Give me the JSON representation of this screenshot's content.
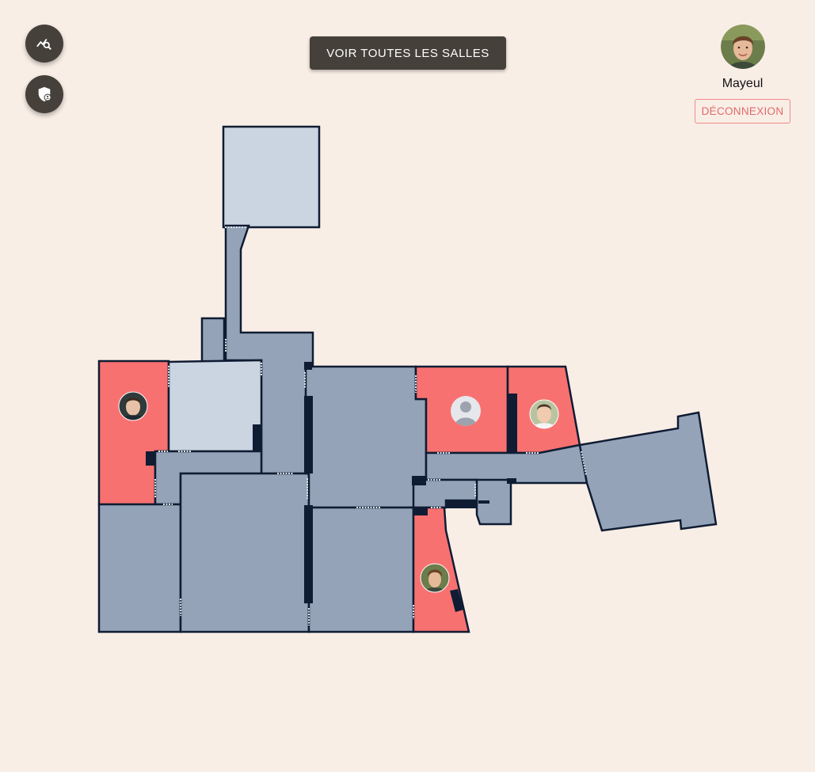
{
  "toolbar": {
    "stats_icon": "stats-search-icon",
    "admin_icon": "shield-user-icon"
  },
  "header": {
    "view_all_rooms_label": "VOIR TOUTES LES SALLES"
  },
  "user": {
    "name": "Mayeul",
    "logout_label": "DÉCONNEXION",
    "avatar_icon": "user-avatar-photo"
  },
  "colors": {
    "background": "#f9eee6",
    "button_dark": "#45403a",
    "room_occupied": "#f87171",
    "room_free": "#94a3b8",
    "room_light": "#cbd5e1",
    "wall": "#0f1c33",
    "logout_accent": "#e06a6a"
  },
  "map": {
    "occupants": [
      {
        "room": "west-room",
        "avatar": "person-avatar-photo"
      },
      {
        "room": "north-east-room-a",
        "avatar": "default-user-silhouette"
      },
      {
        "room": "north-east-room-b",
        "avatar": "person-avatar-photo"
      },
      {
        "room": "south-triangle-room",
        "avatar": "person-avatar-photo"
      }
    ]
  }
}
